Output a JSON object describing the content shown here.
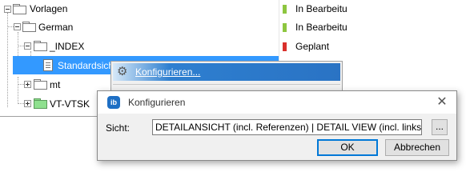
{
  "tree": {
    "nodes": [
      {
        "label": "Vorlagen",
        "expanded": true,
        "icon": "folder-icon"
      },
      {
        "label": "German",
        "expanded": true,
        "icon": "folder-icon"
      },
      {
        "label": "_INDEX",
        "expanded": true,
        "icon": "folder-icon"
      },
      {
        "label": "Standardsicht",
        "icon": "document-icon",
        "selected": true
      },
      {
        "label": "mt",
        "expanded": false,
        "icon": "folder-icon"
      },
      {
        "label": "VT-VTSK",
        "expanded": false,
        "icon": "green-folder-icon"
      }
    ]
  },
  "status_column": [
    {
      "text": "In Bearbeitu",
      "color": "#8dc63f"
    },
    {
      "text": "In Bearbeitu",
      "color": "#8dc63f"
    },
    {
      "text": "Geplant",
      "color": "#d9302c"
    }
  ],
  "context_menu": {
    "items": [
      {
        "label": "Konfigurieren...",
        "icon": "gear-icon"
      }
    ]
  },
  "dialog": {
    "title": "Konfigurieren",
    "app_icon_text": "ib",
    "close_symbol": "✕",
    "view_label": "Sicht:",
    "view_value": "DETAILANSICHT (incl. Referenzen) | DETAIL VIEW (incl. links)",
    "browse_label": "...",
    "ok_label": "OK",
    "cancel_label": "Abbrechen"
  },
  "colors": {
    "selection": "#3399ff",
    "status_green": "#8dc63f",
    "status_red": "#d9302c",
    "folder_green": "#8ee08e"
  }
}
